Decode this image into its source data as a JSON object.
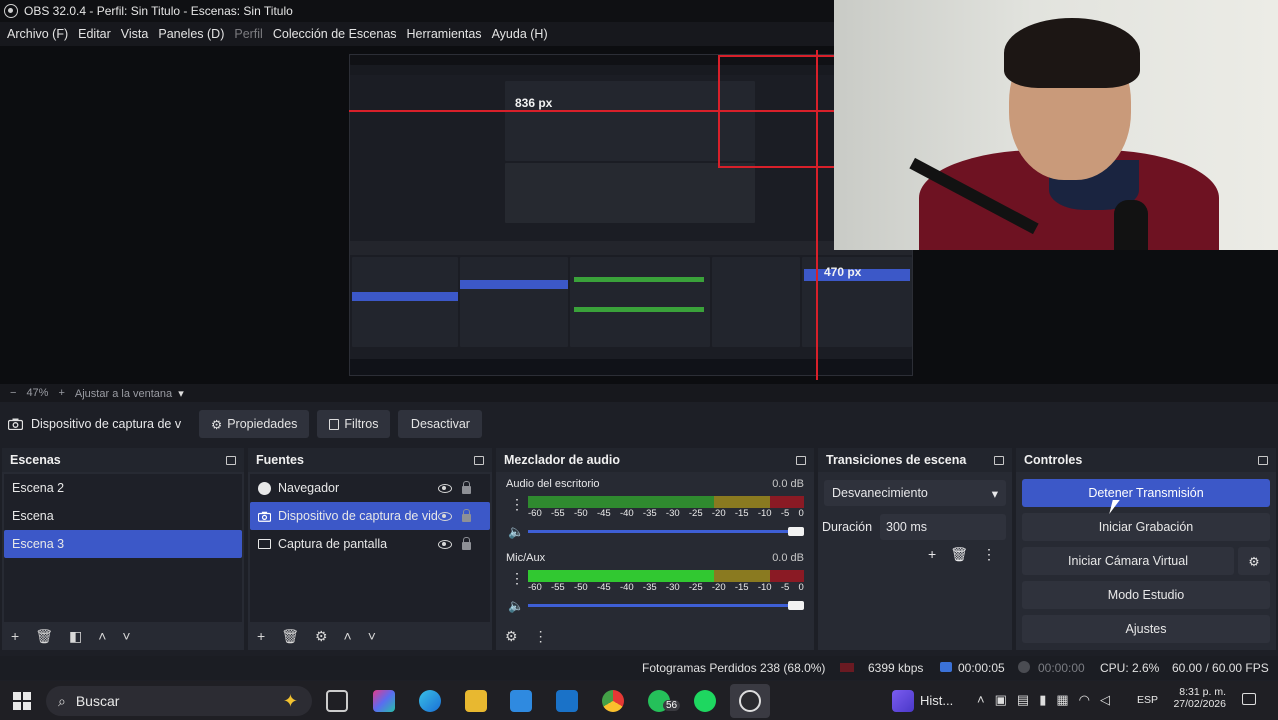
{
  "window": {
    "title": "OBS 32.0.4 - Perfil: Sin Titulo - Escenas: Sin Titulo"
  },
  "menu": [
    {
      "label": "Archivo (F)",
      "enabled": true
    },
    {
      "label": "Editar",
      "enabled": true
    },
    {
      "label": "Vista",
      "enabled": true
    },
    {
      "label": "Paneles (D)",
      "enabled": true
    },
    {
      "label": "Perfil",
      "enabled": false
    },
    {
      "label": "Colección de Escenas",
      "enabled": true
    },
    {
      "label": "Herramientas",
      "enabled": true
    },
    {
      "label": "Ayuda (H)",
      "enabled": true
    }
  ],
  "preview": {
    "width_label": "836 px",
    "height_label": "470 px"
  },
  "zoom": {
    "minus": "−",
    "value": "47%",
    "plus": "+",
    "fit_label": "Ajustar a la ventana"
  },
  "source_toolbar": {
    "source_name": "Dispositivo de captura de v",
    "properties": "Propiedades",
    "filters": "Filtros",
    "deactivate": "Desactivar"
  },
  "scenes": {
    "title": "Escenas",
    "items": [
      {
        "label": "Escena 2",
        "selected": false
      },
      {
        "label": "Escena",
        "selected": false
      },
      {
        "label": "Escena 3",
        "selected": true
      }
    ]
  },
  "sources": {
    "title": "Fuentes",
    "items": [
      {
        "label": "Navegador",
        "icon": "globe-icon",
        "selected": false
      },
      {
        "label": "Dispositivo de captura de vid",
        "icon": "camera-icon",
        "selected": true
      },
      {
        "label": "Captura de pantalla",
        "icon": "monitor-icon",
        "selected": false
      }
    ]
  },
  "mixer": {
    "title": "Mezclador de audio",
    "ticks": [
      "-60",
      "-55",
      "-50",
      "-45",
      "-40",
      "-35",
      "-30",
      "-25",
      "-20",
      "-15",
      "-10",
      "-5",
      "0"
    ],
    "channels": [
      {
        "name": "Audio del escritorio",
        "db": "0.0 dB",
        "level": 1.0
      },
      {
        "name": "Mic/Aux",
        "db": "0.0 dB",
        "level": 1.0
      }
    ]
  },
  "transitions": {
    "title": "Transiciones de escena",
    "selected": "Desvanecimiento",
    "duration_label": "Duración",
    "duration_value": "300 ms"
  },
  "controls": {
    "title": "Controles",
    "stop_stream": "Detener Transmisión",
    "start_recording": "Iniciar Grabación",
    "start_virtual_cam": "Iniciar Cámara Virtual",
    "studio_mode": "Modo Estudio",
    "settings": "Ajustes",
    "accent": "#3c58c8"
  },
  "status": {
    "dropped_frames": "Fotogramas Perdidos 238 (68.0%)",
    "bitrate": "6399 kbps",
    "stream_time": "00:00:05",
    "rec_time": "00:00:00",
    "cpu": "CPU: 2.6%",
    "fps": "60.00 / 60.00 FPS"
  },
  "taskbar": {
    "search_placeholder": "Buscar",
    "whatsapp_badge": "56",
    "teams_label": "Hist...",
    "language": "ESP",
    "time": "8:31 p. m.",
    "date": "27/02/2026"
  }
}
